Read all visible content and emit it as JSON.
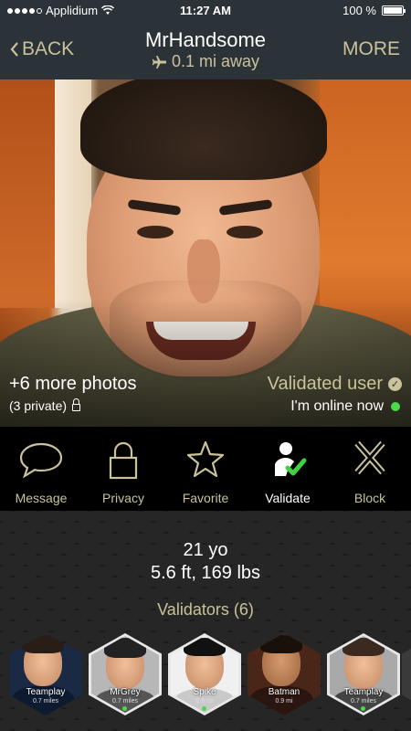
{
  "status": {
    "carrier": "Applidium",
    "time": "11:27 AM",
    "battery": "100 %",
    "battery_level": 1.0,
    "signal_bars_filled": 4,
    "signal_bars_total": 5
  },
  "nav": {
    "back_label": "BACK",
    "title": "MrHandsome",
    "subtitle": "0.1 mi away",
    "more_label": "MORE"
  },
  "photo": {
    "more_photos": "+6 more photos",
    "private_count": "(3 private)",
    "validated_label": "Validated user",
    "online_label": "I'm online now"
  },
  "actions": [
    {
      "label": "Message",
      "icon": "chat-bubble-icon",
      "active": false
    },
    {
      "label": "Privacy",
      "icon": "lock-icon",
      "active": false
    },
    {
      "label": "Favorite",
      "icon": "star-icon",
      "active": false
    },
    {
      "label": "Validate",
      "icon": "validate-user-icon",
      "active": true
    },
    {
      "label": "Block",
      "icon": "block-x-icon",
      "active": false
    }
  ],
  "profile": {
    "age": "21 yo",
    "height_weight": "5.6 ft, 169 lbs",
    "validators_title": "Validators (6)"
  },
  "validators": [
    {
      "name": "Teamplay",
      "distance": "0.7 miles",
      "online": false
    },
    {
      "name": "MrGrey",
      "distance": "0.7 miles",
      "online": true
    },
    {
      "name": "Spike",
      "distance": "0.9 mi",
      "online": true
    },
    {
      "name": "Batman",
      "distance": "0.9 mi",
      "online": false
    },
    {
      "name": "Teamplay",
      "distance": "0.7 miles",
      "online": true
    },
    {
      "name": "",
      "distance": "",
      "online": false
    }
  ],
  "colors": {
    "accent": "#c9c29a",
    "bar": "#2b3238",
    "online": "#4cd94c",
    "validate_check": "#3fd13f"
  }
}
